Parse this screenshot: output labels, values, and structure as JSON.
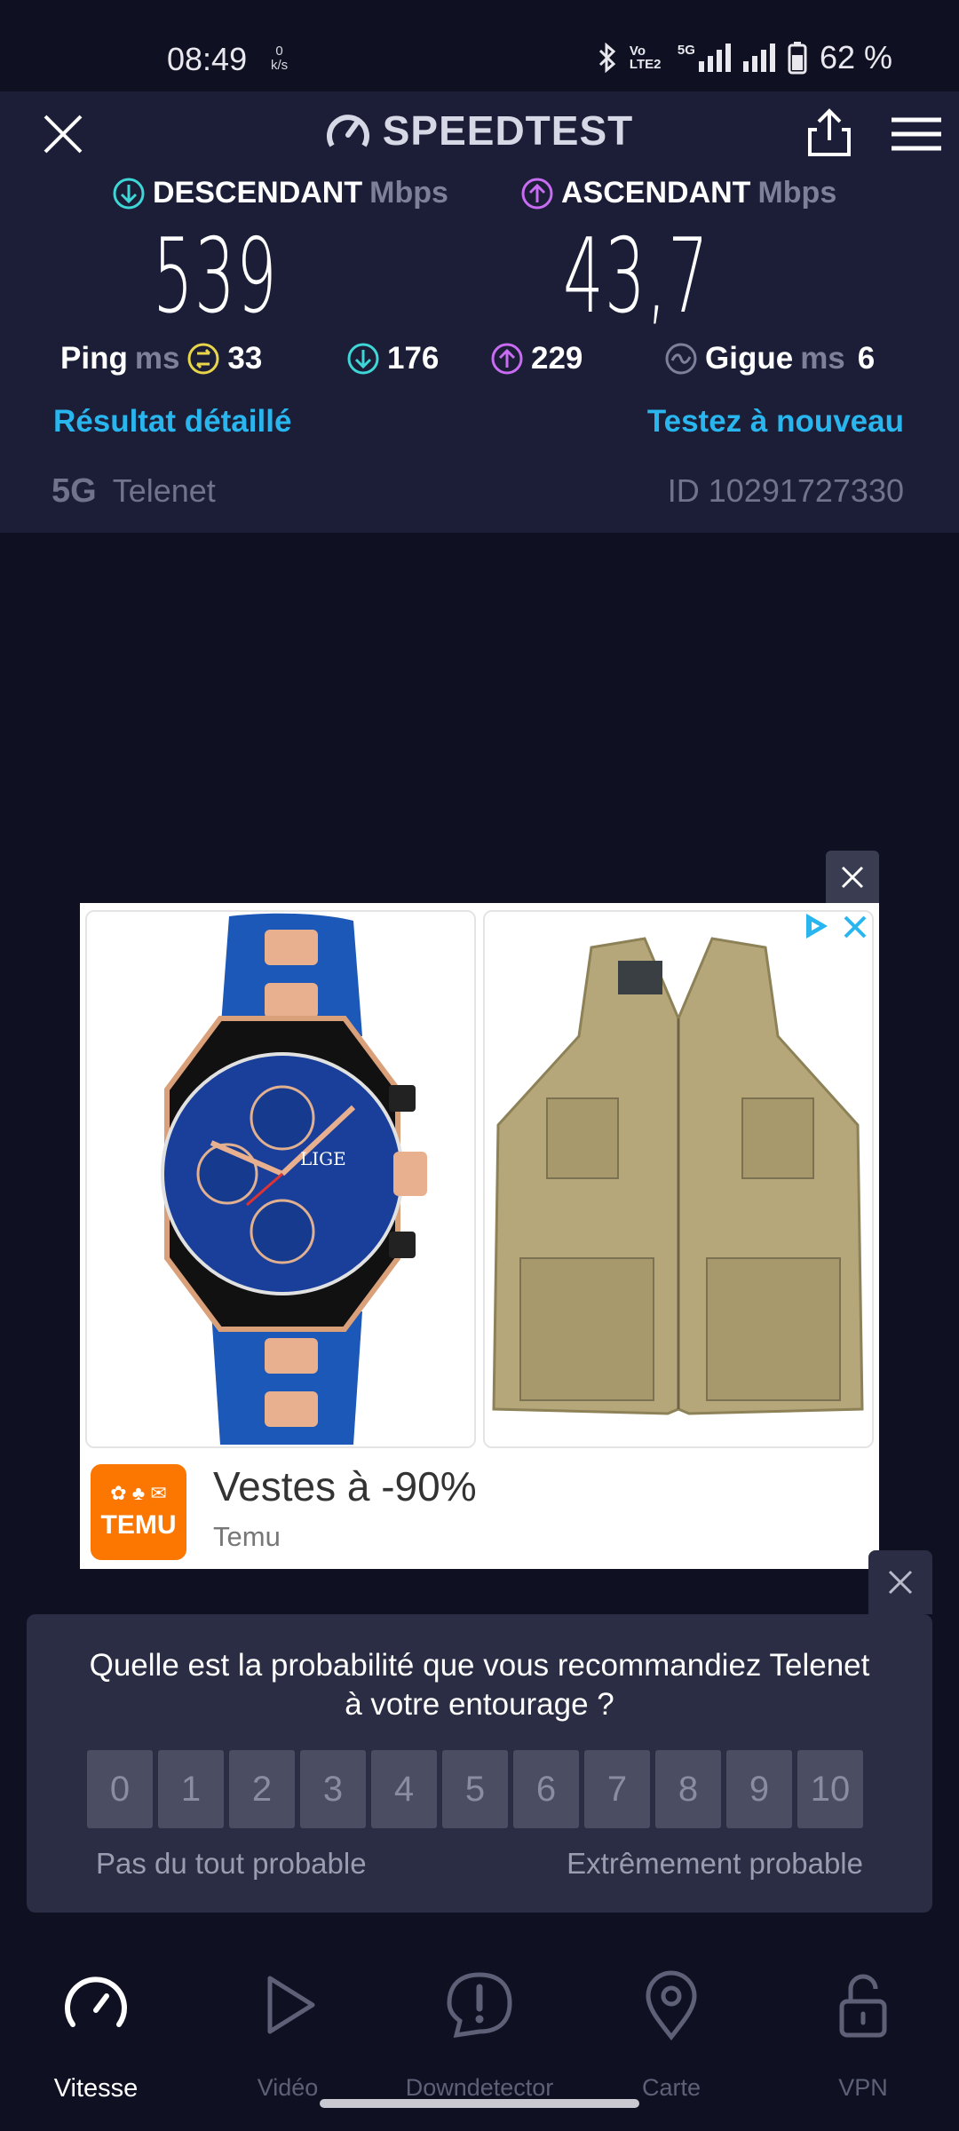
{
  "status_bar": {
    "time": "08:49",
    "net_speed_value": "0",
    "net_speed_unit": "k/s",
    "volte": "Vo LTE2",
    "network": "5G",
    "battery": "62 %"
  },
  "header": {
    "title": "SPEEDTEST"
  },
  "results": {
    "download_label": "DESCENDANT",
    "download_unit": "Mbps",
    "download_value": "539",
    "upload_label": "ASCENDANT",
    "upload_unit": "Mbps",
    "upload_value": "43,7",
    "ping_label": "Ping",
    "ping_unit": "ms",
    "ping_idle": "33",
    "ping_download": "176",
    "ping_upload": "229",
    "jitter_label": "Gigue",
    "jitter_unit": "ms",
    "jitter_value": "6",
    "detailed_link": "Résultat détaillé",
    "retest_link": "Testez à nouveau",
    "network_type": "5G",
    "provider": "Telenet",
    "result_id": "ID 10291727330"
  },
  "ad": {
    "title": "Vestes à -90%",
    "advertiser": "Temu",
    "logo_text": "TEMU",
    "watch_brand": "LIGE"
  },
  "survey": {
    "question": "Quelle est la probabilité que vous recommandiez Telenet à votre entourage ?",
    "scale": [
      "0",
      "1",
      "2",
      "3",
      "4",
      "5",
      "6",
      "7",
      "8",
      "9",
      "10"
    ],
    "low_label": "Pas du tout probable",
    "high_label": "Extrêmement probable"
  },
  "nav": {
    "items": [
      {
        "label": "Vitesse",
        "icon": "speedometer-icon"
      },
      {
        "label": "Vidéo",
        "icon": "play-icon"
      },
      {
        "label": "Downdetector",
        "icon": "alert-icon"
      },
      {
        "label": "Carte",
        "icon": "map-pin-icon"
      },
      {
        "label": "VPN",
        "icon": "unlock-icon"
      }
    ],
    "active_index": 0
  },
  "colors": {
    "background": "#0f1123",
    "card": "#1b1e36",
    "download_accent": "#3ed6d6",
    "upload_accent": "#c86cf3",
    "link": "#29b6ef",
    "ping_accent": "#e8d54a",
    "temu_orange": "#fb7701"
  }
}
